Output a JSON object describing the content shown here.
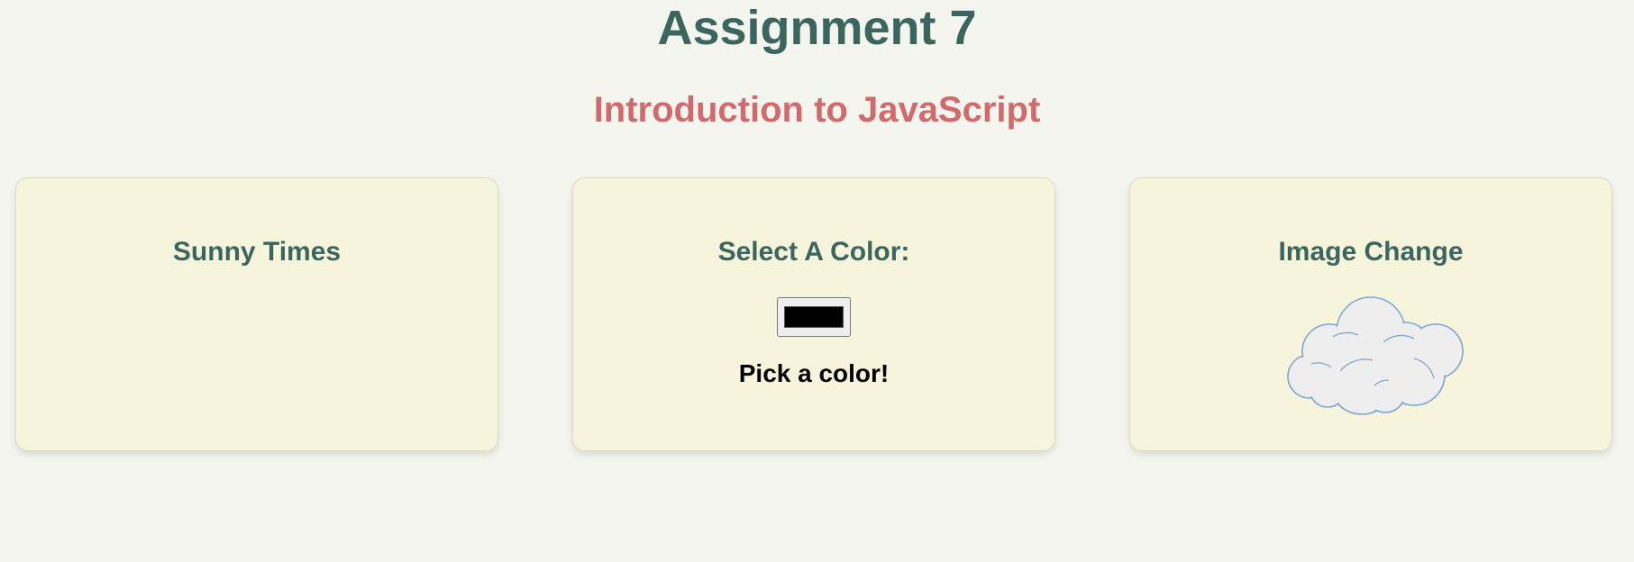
{
  "header": {
    "title": "Assignment 7",
    "subtitle": "Introduction to JavaScript"
  },
  "cards": [
    {
      "title": "Sunny Times"
    },
    {
      "title": "Select A Color:",
      "color_value": "#000000",
      "caption": "Pick a color!"
    },
    {
      "title": "Image Change",
      "image": "cloud-icon"
    }
  ],
  "colors": {
    "background": "#f3f5ee",
    "card_background": "#f6f5dc",
    "title": "#3b6660",
    "subtitle": "#d26a6c",
    "cloud_fill": "#eeeeee",
    "cloud_stroke": "#7aa6d4"
  }
}
